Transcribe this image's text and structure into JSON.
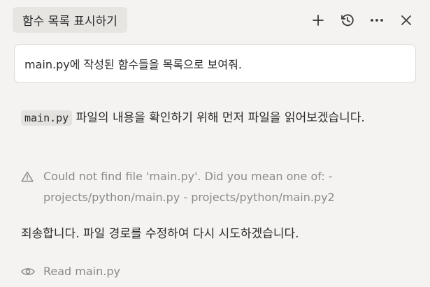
{
  "header": {
    "title": "함수 목록 표시하기",
    "actions": {
      "add_icon": "plus-icon",
      "history_icon": "history-icon",
      "more_icon": "more-horizontal-icon",
      "close_icon": "close-icon"
    }
  },
  "user_message": {
    "text": "main.py에 작성된 함수들을 목록으로 보여줘."
  },
  "assistant": {
    "intro_code": "main.py",
    "intro_text": " 파일의 내용을 확인하기 위해 먼저 파일을 읽어보겠습니다.",
    "warning": {
      "icon": "warning-triangle-icon",
      "text": "Could not find file 'main.py'. Did you mean one of: - projects/python/main.py - projects/python/main.py2"
    },
    "apology_text": "죄송합니다. 파일 경로를 수정하여 다시 시도하겠습니다.",
    "read_step": {
      "icon": "eye-icon",
      "text": "Read main.py"
    }
  },
  "colors": {
    "background": "#f4f3f1",
    "chip": "#e6e5e2",
    "muted_text": "#8a8a8a",
    "code_bg": "#e3e2df"
  }
}
